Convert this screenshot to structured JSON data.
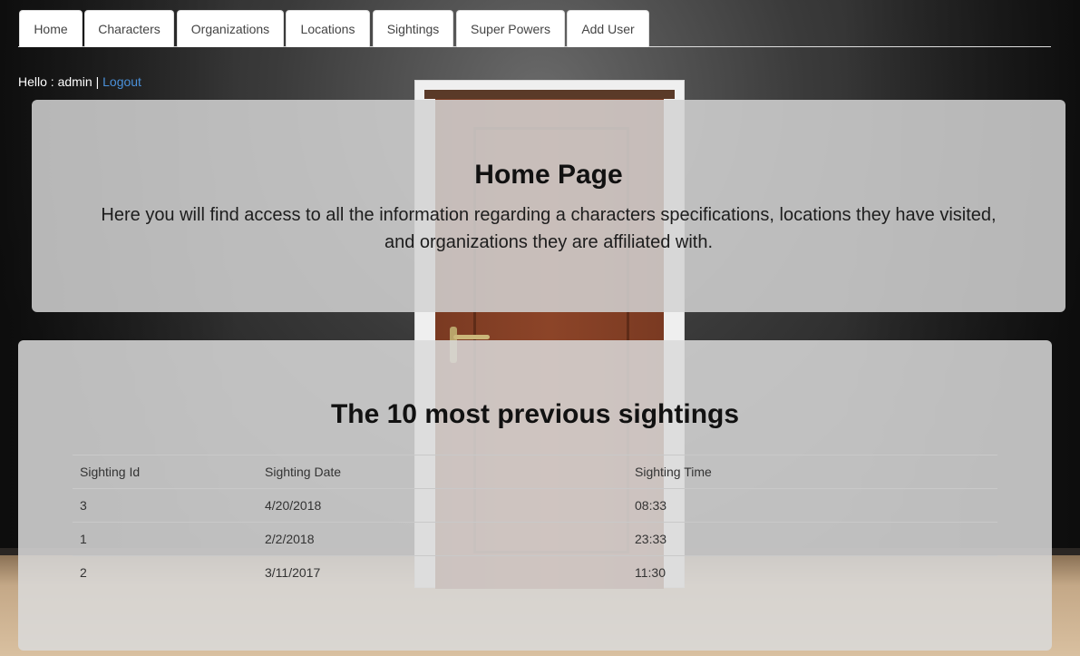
{
  "nav": {
    "tabs": [
      {
        "label": "Home"
      },
      {
        "label": "Characters"
      },
      {
        "label": "Organizations"
      },
      {
        "label": "Locations"
      },
      {
        "label": "Sightings"
      },
      {
        "label": "Super Powers"
      },
      {
        "label": "Add User"
      }
    ]
  },
  "user_bar": {
    "greeting": "Hello : admin |",
    "logout_label": "Logout"
  },
  "jumbotron": {
    "title": "Home Page",
    "description": "Here you will find access to all the information regarding a characters specifications, locations they have visited, and organizations they are affiliated with."
  },
  "sightings": {
    "title": "The 10 most previous sightings",
    "columns": [
      "Sighting Id",
      "Sighting Date",
      "Sighting Time"
    ],
    "rows": [
      {
        "id": "3",
        "date": "4/20/2018",
        "time": "08:33"
      },
      {
        "id": "1",
        "date": "2/2/2018",
        "time": "23:33"
      },
      {
        "id": "2",
        "date": "3/11/2017",
        "time": "11:30"
      }
    ]
  },
  "colors": {
    "link": "#4a90d9",
    "panel": "#d3d3d3",
    "door": "#8c4428"
  }
}
